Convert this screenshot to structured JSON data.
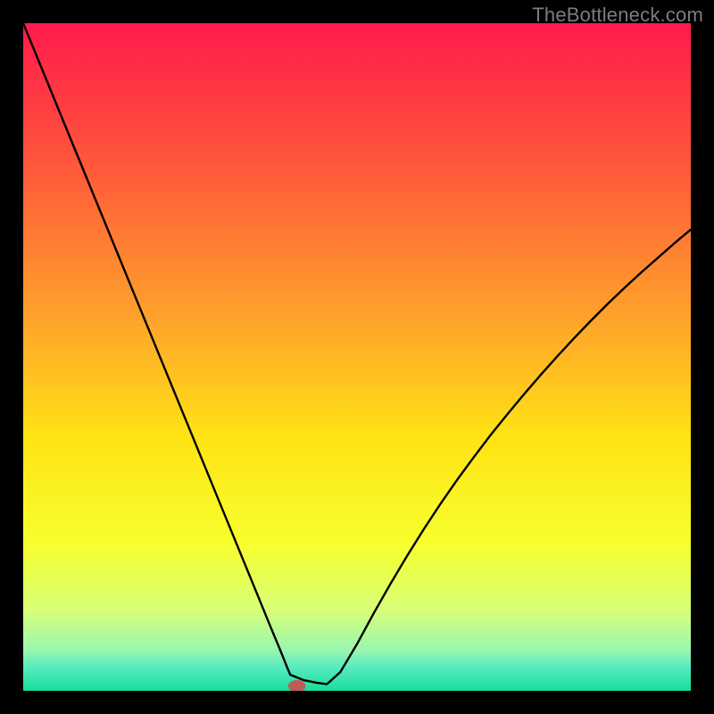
{
  "watermark": "TheBottleneck.com",
  "chart_data": {
    "type": "line",
    "title": "",
    "xlabel": "",
    "ylabel": "",
    "xlim": [
      0,
      100
    ],
    "ylim": [
      0,
      100
    ],
    "grid": false,
    "legend": false,
    "background_gradient": {
      "stops": [
        {
          "offset": 0.0,
          "color": "#ff1a4b"
        },
        {
          "offset": 0.22,
          "color": "#ff5a3a"
        },
        {
          "offset": 0.45,
          "color": "#ffa52a"
        },
        {
          "offset": 0.62,
          "color": "#ffe314"
        },
        {
          "offset": 0.78,
          "color": "#f7ff2e"
        },
        {
          "offset": 0.88,
          "color": "#d7ff78"
        },
        {
          "offset": 0.94,
          "color": "#97f7b0"
        },
        {
          "offset": 0.965,
          "color": "#57eac0"
        },
        {
          "offset": 1.0,
          "color": "#17dd9a"
        }
      ]
    },
    "series": [
      {
        "name": "bottleneck-curve",
        "color": "#000000",
        "x": [
          0.0,
          2.5,
          5.0,
          7.5,
          10.0,
          12.5,
          15.0,
          17.5,
          20.0,
          22.5,
          25.0,
          27.5,
          30.0,
          32.5,
          35.0,
          37.0,
          38.5,
          39.5,
          40.0,
          42.0,
          44.0,
          45.5,
          47.5,
          50.0,
          52.5,
          55.0,
          57.5,
          60.0,
          62.5,
          65.0,
          67.5,
          70.0,
          72.5,
          75.0,
          77.5,
          80.0,
          82.5,
          85.0,
          87.5,
          90.0,
          92.5,
          95.0,
          97.5,
          100.0
        ],
        "y": [
          100.0,
          93.9,
          87.8,
          81.7,
          75.6,
          69.5,
          63.4,
          57.3,
          51.2,
          45.1,
          39.0,
          32.9,
          26.8,
          20.7,
          14.6,
          9.7,
          6.1,
          3.6,
          2.4,
          1.6,
          1.2,
          1.0,
          2.8,
          7.0,
          11.6,
          16.0,
          20.2,
          24.2,
          28.0,
          31.6,
          35.0,
          38.3,
          41.4,
          44.4,
          47.3,
          50.1,
          52.8,
          55.4,
          57.9,
          60.3,
          62.6,
          64.8,
          67.0,
          69.1
        ]
      }
    ],
    "marker": {
      "name": "optimal-point",
      "x": 41.0,
      "y": 0.7,
      "rx": 1.3,
      "ry": 0.9,
      "color": "#c15a55"
    }
  }
}
